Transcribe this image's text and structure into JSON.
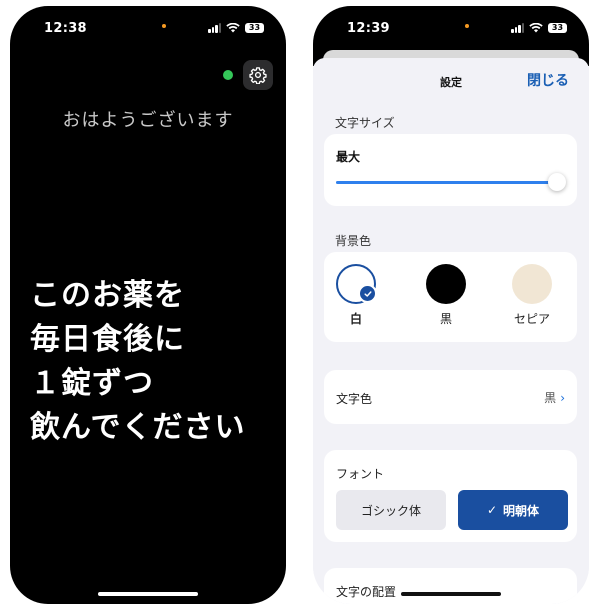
{
  "left_phone": {
    "time": "12:38",
    "battery": "33",
    "greeting": "おはようございます",
    "message_lines": [
      "このお薬を",
      "毎日食後に",
      "１錠ずつ",
      "飲んでください"
    ]
  },
  "right_phone": {
    "time": "12:39",
    "battery": "33",
    "nav": {
      "title": "設定",
      "close_label": "閉じる"
    },
    "text_size": {
      "section_label": "文字サイズ",
      "value": "最大",
      "slider_fraction": 0.98
    },
    "background": {
      "section_label": "背景色",
      "options": [
        {
          "label": "白",
          "color": "#ffffff",
          "selected": true
        },
        {
          "label": "黒",
          "color": "#000000",
          "selected": false
        },
        {
          "label": "セピア",
          "color": "#f1e6d4",
          "selected": false
        }
      ]
    },
    "text_color": {
      "label": "文字色",
      "value": "黒"
    },
    "font": {
      "label": "フォント",
      "options": [
        "ゴシック体",
        "明朝体"
      ],
      "selected_check": "✓"
    },
    "alignment": {
      "section_label": "文字の配置"
    }
  },
  "colors": {
    "accent": "#1a4fa0",
    "link": "#1a5fb4",
    "slider": "#2f80ed",
    "status_green": "#34c759"
  }
}
